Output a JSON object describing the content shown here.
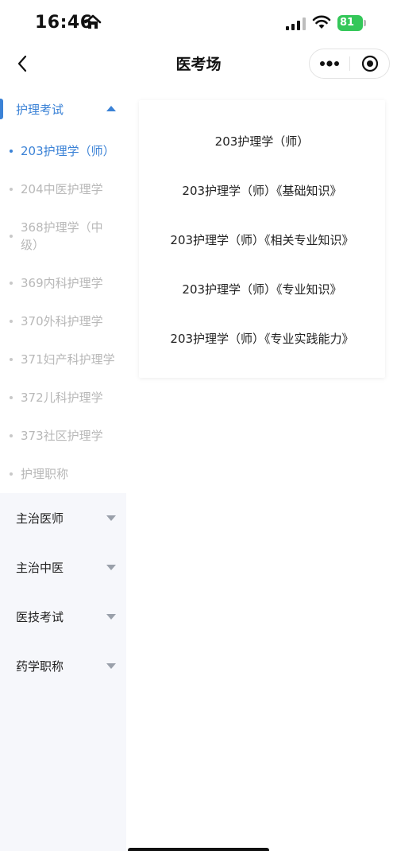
{
  "status_bar": {
    "time": "16:46",
    "battery": "81",
    "home_icon": "house-icon",
    "battery_color": "#34c759"
  },
  "nav": {
    "title": "医考场"
  },
  "theme": {
    "accent": "#3b82d6"
  },
  "sidebar": {
    "open_group": {
      "label": "护理考试",
      "items": [
        {
          "label": "203护理学（师）"
        },
        {
          "label": "204中医护理学"
        },
        {
          "label": "368护理学（中级）"
        },
        {
          "label": "369内科护理学"
        },
        {
          "label": "370外科护理学"
        },
        {
          "label": "371妇产科护理学"
        },
        {
          "label": "372儿科护理学"
        },
        {
          "label": "373社区护理学"
        },
        {
          "label": "护理职称"
        }
      ]
    },
    "groups": [
      {
        "label": "主治医师"
      },
      {
        "label": "主治中医"
      },
      {
        "label": "医技考试"
      },
      {
        "label": "药学职称"
      }
    ]
  },
  "content": {
    "subjects": [
      {
        "label": "203护理学（师）"
      },
      {
        "label": "203护理学（师）《基础知识》"
      },
      {
        "label": "203护理学（师）《相关专业知识》"
      },
      {
        "label": "203护理学（师）《专业知识》"
      },
      {
        "label": "203护理学（师）《专业实践能力》"
      }
    ]
  }
}
